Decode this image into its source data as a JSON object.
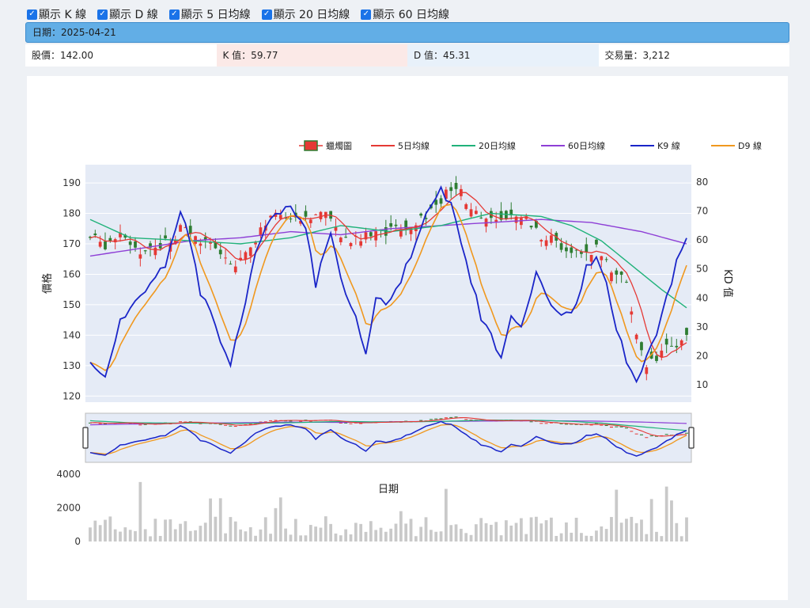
{
  "toolbar": {
    "checkboxes": [
      {
        "label": "顯示 K 線",
        "checked": true
      },
      {
        "label": "顯示 D 線",
        "checked": true
      },
      {
        "label": "顯示 5 日均線",
        "checked": true
      },
      {
        "label": "顯示 20 日均線",
        "checked": true
      },
      {
        "label": "顯示 60 日均線",
        "checked": true
      }
    ]
  },
  "info": {
    "date_text": "日期：2025-04-21",
    "price_text": "股價：142.00",
    "k_text": "K 值：59.77",
    "d_text": "D 值：45.31",
    "volume_text": "交易量：3,212"
  },
  "chart_data": {
    "type": "candlestick",
    "colors": {
      "up": "#e53935",
      "down": "#2e7d32",
      "ma5": "#e53935",
      "ma20": "#20b27a",
      "ma60": "#8e3fd6",
      "k9": "#1a25c8",
      "d9": "#f0981e",
      "volume": "#c9c9c9",
      "plot_bg": "#e5ebf6"
    },
    "legend": [
      {
        "name": "蠟燭圖",
        "color": "#e53935",
        "kind": "candle"
      },
      {
        "name": "5日均線",
        "color": "#e53935",
        "kind": "line"
      },
      {
        "name": "20日均線",
        "color": "#20b27a",
        "kind": "line"
      },
      {
        "name": "60日均線",
        "color": "#8e3fd6",
        "kind": "line"
      },
      {
        "name": "K9 線",
        "color": "#1a25c8",
        "kind": "line"
      },
      {
        "name": "D9 線",
        "color": "#f0981e",
        "kind": "line"
      },
      {
        "name": "交易量",
        "color": "#c9c9c9",
        "kind": "box"
      }
    ],
    "legend_position": "top-right",
    "price_axis": {
      "title": "價格",
      "ticks": [
        120,
        130,
        140,
        150,
        160,
        170,
        180,
        190
      ],
      "range": [
        118,
        196
      ]
    },
    "kd_axis": {
      "title": "KD 值",
      "ticks": [
        10,
        20,
        30,
        40,
        50,
        60,
        70,
        80
      ],
      "range": [
        4,
        86
      ]
    },
    "volume_axis": {
      "ticks": [
        0,
        2000,
        4000
      ],
      "range": [
        0,
        4600
      ]
    },
    "x_title": "日期",
    "kd_anchor": [
      [
        0,
        19
      ],
      [
        3,
        13
      ],
      [
        6,
        33
      ],
      [
        10,
        40
      ],
      [
        15,
        52
      ],
      [
        18,
        70
      ],
      [
        20,
        60
      ],
      [
        22,
        42
      ],
      [
        25,
        30
      ],
      [
        28,
        18
      ],
      [
        30,
        30
      ],
      [
        33,
        55
      ],
      [
        36,
        67
      ],
      [
        40,
        72
      ],
      [
        43,
        65
      ],
      [
        45,
        45
      ],
      [
        48,
        62
      ],
      [
        50,
        47
      ],
      [
        53,
        33
      ],
      [
        55,
        20
      ],
      [
        57,
        40
      ],
      [
        59,
        38
      ],
      [
        62,
        46
      ],
      [
        65,
        60
      ],
      [
        67,
        68
      ],
      [
        70,
        77
      ],
      [
        72,
        72
      ],
      [
        75,
        53
      ],
      [
        78,
        33
      ],
      [
        82,
        20
      ],
      [
        84,
        35
      ],
      [
        86,
        30
      ],
      [
        89,
        48
      ],
      [
        92,
        36
      ],
      [
        95,
        34
      ],
      [
        97,
        37
      ],
      [
        99,
        50
      ],
      [
        101,
        54
      ],
      [
        103,
        45
      ],
      [
        105,
        30
      ],
      [
        107,
        18
      ],
      [
        109,
        12
      ],
      [
        111,
        20
      ],
      [
        113,
        26
      ],
      [
        115,
        40
      ],
      [
        117,
        52
      ],
      [
        119,
        60
      ]
    ],
    "price_anchor": [
      [
        0,
        172
      ],
      [
        3,
        170
      ],
      [
        6,
        172
      ],
      [
        9,
        169
      ],
      [
        11,
        167
      ],
      [
        14,
        170
      ],
      [
        17,
        173
      ],
      [
        19,
        177
      ],
      [
        21,
        171
      ],
      [
        24,
        169
      ],
      [
        27,
        166
      ],
      [
        29,
        163
      ],
      [
        31,
        167
      ],
      [
        33,
        172
      ],
      [
        36,
        178
      ],
      [
        39,
        179
      ],
      [
        42,
        176
      ],
      [
        44,
        178
      ],
      [
        46,
        180
      ],
      [
        48,
        178
      ],
      [
        51,
        172
      ],
      [
        54,
        171
      ],
      [
        57,
        175
      ],
      [
        60,
        174
      ],
      [
        63,
        176
      ],
      [
        66,
        179
      ],
      [
        68,
        181
      ],
      [
        70,
        184
      ],
      [
        72,
        188
      ],
      [
        74,
        186
      ],
      [
        76,
        182
      ],
      [
        78,
        179
      ],
      [
        81,
        177
      ],
      [
        84,
        178
      ],
      [
        87,
        178
      ],
      [
        90,
        173
      ],
      [
        92,
        172
      ],
      [
        95,
        167
      ],
      [
        98,
        167
      ],
      [
        101,
        168
      ],
      [
        103,
        164
      ],
      [
        105,
        160
      ],
      [
        107,
        158
      ],
      [
        109,
        140
      ],
      [
        111,
        129
      ],
      [
        113,
        132
      ],
      [
        115,
        137
      ],
      [
        117,
        138
      ],
      [
        119,
        142
      ]
    ],
    "ma20_anchor": [
      [
        0,
        178
      ],
      [
        8,
        172
      ],
      [
        20,
        171
      ],
      [
        30,
        170
      ],
      [
        40,
        172
      ],
      [
        50,
        176
      ],
      [
        60,
        174
      ],
      [
        70,
        176
      ],
      [
        80,
        180
      ],
      [
        90,
        179
      ],
      [
        96,
        176
      ],
      [
        102,
        171
      ],
      [
        108,
        163
      ],
      [
        114,
        155
      ],
      [
        119,
        149
      ]
    ],
    "ma60_anchor": [
      [
        0,
        166
      ],
      [
        20,
        171
      ],
      [
        30,
        172
      ],
      [
        40,
        174
      ],
      [
        50,
        173
      ],
      [
        60,
        175
      ],
      [
        70,
        176
      ],
      [
        80,
        177
      ],
      [
        90,
        178
      ],
      [
        100,
        177
      ],
      [
        110,
        174
      ],
      [
        119,
        170
      ]
    ],
    "n_days": 120
  }
}
